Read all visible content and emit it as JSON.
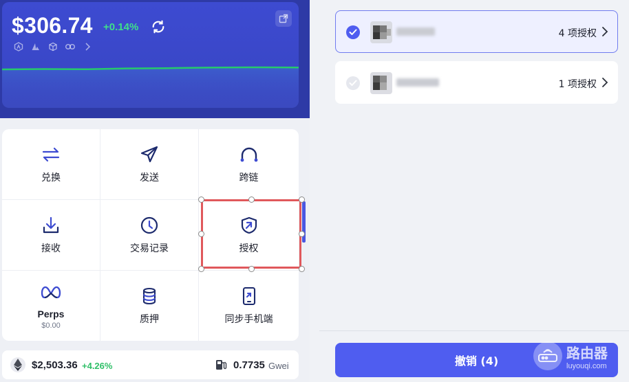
{
  "wallet": {
    "balance": "$306.74",
    "change": "+0.14%",
    "colors": {
      "hero": "#3d4bd1",
      "positive": "#3fe08a",
      "chart_line": "#27c96b"
    },
    "chain_icons": [
      "arbitrum-icon",
      "avalanche-icon",
      "cube-icon",
      "link-icon",
      "chevron-right-icon"
    ]
  },
  "actions": [
    {
      "label": "兑换",
      "icon": "swap-icon"
    },
    {
      "label": "发送",
      "icon": "send-icon"
    },
    {
      "label": "跨链",
      "icon": "bridge-icon"
    },
    {
      "label": "接收",
      "icon": "receive-icon"
    },
    {
      "label": "交易记录",
      "icon": "history-icon"
    },
    {
      "label": "授权",
      "icon": "approval-shield-icon"
    },
    {
      "label": "Perps",
      "sub": "$0.00",
      "icon": "perps-icon"
    },
    {
      "label": "质押",
      "icon": "stake-icon"
    },
    {
      "label": "同步手机端",
      "icon": "phone-sync-icon"
    }
  ],
  "footer": {
    "eth_price": "$2,503.36",
    "eth_change": "+4.26%",
    "gas_value": "0.7735",
    "gas_unit": "Gwei"
  },
  "approvals": {
    "items": [
      {
        "selected": true,
        "count_label": "4 项授权"
      },
      {
        "selected": false,
        "count_label": "1 项授权"
      }
    ],
    "revoke_label": "撤销 (4)",
    "accent": "#4f5df0"
  },
  "watermark": {
    "title": "路由器",
    "url": "luyouqi.com"
  }
}
